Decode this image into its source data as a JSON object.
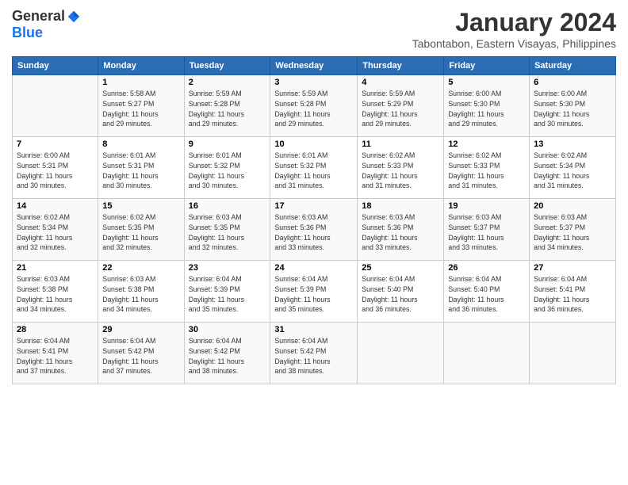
{
  "header": {
    "logo_general": "General",
    "logo_blue": "Blue",
    "month_year": "January 2024",
    "location": "Tabontabon, Eastern Visayas, Philippines"
  },
  "days_of_week": [
    "Sunday",
    "Monday",
    "Tuesday",
    "Wednesday",
    "Thursday",
    "Friday",
    "Saturday"
  ],
  "weeks": [
    [
      {
        "num": "",
        "sunrise": "",
        "sunset": "",
        "daylight": ""
      },
      {
        "num": "1",
        "sunrise": "Sunrise: 5:58 AM",
        "sunset": "Sunset: 5:27 PM",
        "daylight": "Daylight: 11 hours and 29 minutes."
      },
      {
        "num": "2",
        "sunrise": "Sunrise: 5:59 AM",
        "sunset": "Sunset: 5:28 PM",
        "daylight": "Daylight: 11 hours and 29 minutes."
      },
      {
        "num": "3",
        "sunrise": "Sunrise: 5:59 AM",
        "sunset": "Sunset: 5:28 PM",
        "daylight": "Daylight: 11 hours and 29 minutes."
      },
      {
        "num": "4",
        "sunrise": "Sunrise: 5:59 AM",
        "sunset": "Sunset: 5:29 PM",
        "daylight": "Daylight: 11 hours and 29 minutes."
      },
      {
        "num": "5",
        "sunrise": "Sunrise: 6:00 AM",
        "sunset": "Sunset: 5:30 PM",
        "daylight": "Daylight: 11 hours and 29 minutes."
      },
      {
        "num": "6",
        "sunrise": "Sunrise: 6:00 AM",
        "sunset": "Sunset: 5:30 PM",
        "daylight": "Daylight: 11 hours and 30 minutes."
      }
    ],
    [
      {
        "num": "7",
        "sunrise": "Sunrise: 6:00 AM",
        "sunset": "Sunset: 5:31 PM",
        "daylight": "Daylight: 11 hours and 30 minutes."
      },
      {
        "num": "8",
        "sunrise": "Sunrise: 6:01 AM",
        "sunset": "Sunset: 5:31 PM",
        "daylight": "Daylight: 11 hours and 30 minutes."
      },
      {
        "num": "9",
        "sunrise": "Sunrise: 6:01 AM",
        "sunset": "Sunset: 5:32 PM",
        "daylight": "Daylight: 11 hours and 30 minutes."
      },
      {
        "num": "10",
        "sunrise": "Sunrise: 6:01 AM",
        "sunset": "Sunset: 5:32 PM",
        "daylight": "Daylight: 11 hours and 31 minutes."
      },
      {
        "num": "11",
        "sunrise": "Sunrise: 6:02 AM",
        "sunset": "Sunset: 5:33 PM",
        "daylight": "Daylight: 11 hours and 31 minutes."
      },
      {
        "num": "12",
        "sunrise": "Sunrise: 6:02 AM",
        "sunset": "Sunset: 5:33 PM",
        "daylight": "Daylight: 11 hours and 31 minutes."
      },
      {
        "num": "13",
        "sunrise": "Sunrise: 6:02 AM",
        "sunset": "Sunset: 5:34 PM",
        "daylight": "Daylight: 11 hours and 31 minutes."
      }
    ],
    [
      {
        "num": "14",
        "sunrise": "Sunrise: 6:02 AM",
        "sunset": "Sunset: 5:34 PM",
        "daylight": "Daylight: 11 hours and 32 minutes."
      },
      {
        "num": "15",
        "sunrise": "Sunrise: 6:02 AM",
        "sunset": "Sunset: 5:35 PM",
        "daylight": "Daylight: 11 hours and 32 minutes."
      },
      {
        "num": "16",
        "sunrise": "Sunrise: 6:03 AM",
        "sunset": "Sunset: 5:35 PM",
        "daylight": "Daylight: 11 hours and 32 minutes."
      },
      {
        "num": "17",
        "sunrise": "Sunrise: 6:03 AM",
        "sunset": "Sunset: 5:36 PM",
        "daylight": "Daylight: 11 hours and 33 minutes."
      },
      {
        "num": "18",
        "sunrise": "Sunrise: 6:03 AM",
        "sunset": "Sunset: 5:36 PM",
        "daylight": "Daylight: 11 hours and 33 minutes."
      },
      {
        "num": "19",
        "sunrise": "Sunrise: 6:03 AM",
        "sunset": "Sunset: 5:37 PM",
        "daylight": "Daylight: 11 hours and 33 minutes."
      },
      {
        "num": "20",
        "sunrise": "Sunrise: 6:03 AM",
        "sunset": "Sunset: 5:37 PM",
        "daylight": "Daylight: 11 hours and 34 minutes."
      }
    ],
    [
      {
        "num": "21",
        "sunrise": "Sunrise: 6:03 AM",
        "sunset": "Sunset: 5:38 PM",
        "daylight": "Daylight: 11 hours and 34 minutes."
      },
      {
        "num": "22",
        "sunrise": "Sunrise: 6:03 AM",
        "sunset": "Sunset: 5:38 PM",
        "daylight": "Daylight: 11 hours and 34 minutes."
      },
      {
        "num": "23",
        "sunrise": "Sunrise: 6:04 AM",
        "sunset": "Sunset: 5:39 PM",
        "daylight": "Daylight: 11 hours and 35 minutes."
      },
      {
        "num": "24",
        "sunrise": "Sunrise: 6:04 AM",
        "sunset": "Sunset: 5:39 PM",
        "daylight": "Daylight: 11 hours and 35 minutes."
      },
      {
        "num": "25",
        "sunrise": "Sunrise: 6:04 AM",
        "sunset": "Sunset: 5:40 PM",
        "daylight": "Daylight: 11 hours and 36 minutes."
      },
      {
        "num": "26",
        "sunrise": "Sunrise: 6:04 AM",
        "sunset": "Sunset: 5:40 PM",
        "daylight": "Daylight: 11 hours and 36 minutes."
      },
      {
        "num": "27",
        "sunrise": "Sunrise: 6:04 AM",
        "sunset": "Sunset: 5:41 PM",
        "daylight": "Daylight: 11 hours and 36 minutes."
      }
    ],
    [
      {
        "num": "28",
        "sunrise": "Sunrise: 6:04 AM",
        "sunset": "Sunset: 5:41 PM",
        "daylight": "Daylight: 11 hours and 37 minutes."
      },
      {
        "num": "29",
        "sunrise": "Sunrise: 6:04 AM",
        "sunset": "Sunset: 5:42 PM",
        "daylight": "Daylight: 11 hours and 37 minutes."
      },
      {
        "num": "30",
        "sunrise": "Sunrise: 6:04 AM",
        "sunset": "Sunset: 5:42 PM",
        "daylight": "Daylight: 11 hours and 38 minutes."
      },
      {
        "num": "31",
        "sunrise": "Sunrise: 6:04 AM",
        "sunset": "Sunset: 5:42 PM",
        "daylight": "Daylight: 11 hours and 38 minutes."
      },
      {
        "num": "",
        "sunrise": "",
        "sunset": "",
        "daylight": ""
      },
      {
        "num": "",
        "sunrise": "",
        "sunset": "",
        "daylight": ""
      },
      {
        "num": "",
        "sunrise": "",
        "sunset": "",
        "daylight": ""
      }
    ]
  ]
}
